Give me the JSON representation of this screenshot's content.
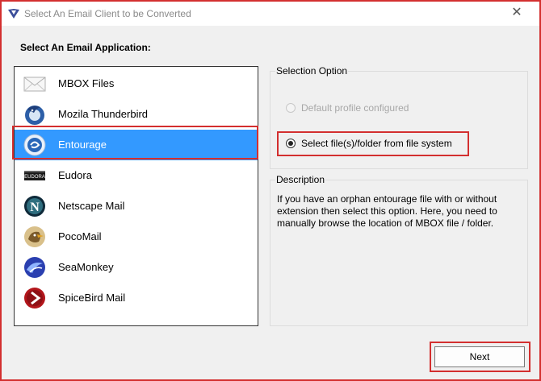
{
  "window": {
    "title": "Select An Email Client to be Converted",
    "close_glyph": "✕"
  },
  "left_panel": {
    "label": "Select An Email Application:",
    "items": [
      {
        "label": "MBOX Files",
        "icon": "envelope-icon"
      },
      {
        "label": "Mozila Thunderbird",
        "icon": "thunderbird-icon"
      },
      {
        "label": "Entourage",
        "icon": "entourage-icon",
        "selected": true
      },
      {
        "label": "Eudora",
        "icon": "eudora-icon"
      },
      {
        "label": "Netscape Mail",
        "icon": "netscape-icon"
      },
      {
        "label": "PocoMail",
        "icon": "pocomail-icon"
      },
      {
        "label": "SeaMonkey",
        "icon": "seamonkey-icon"
      },
      {
        "label": "SpiceBird Mail",
        "icon": "spicebird-icon"
      }
    ]
  },
  "selection_option": {
    "title": "Selection Option",
    "options": [
      {
        "label": "Default profile configured",
        "enabled": false,
        "checked": false
      },
      {
        "label": "Select file(s)/folder from file system",
        "enabled": true,
        "checked": true
      }
    ]
  },
  "description": {
    "title": "Description",
    "text": "If you have an orphan entourage file with or without extension then select this option. Here, you need to manually browse the location of MBOX file / folder."
  },
  "buttons": {
    "next": "Next"
  },
  "colors": {
    "highlight_red": "#d32f2f",
    "selection_blue": "#3399ff"
  }
}
